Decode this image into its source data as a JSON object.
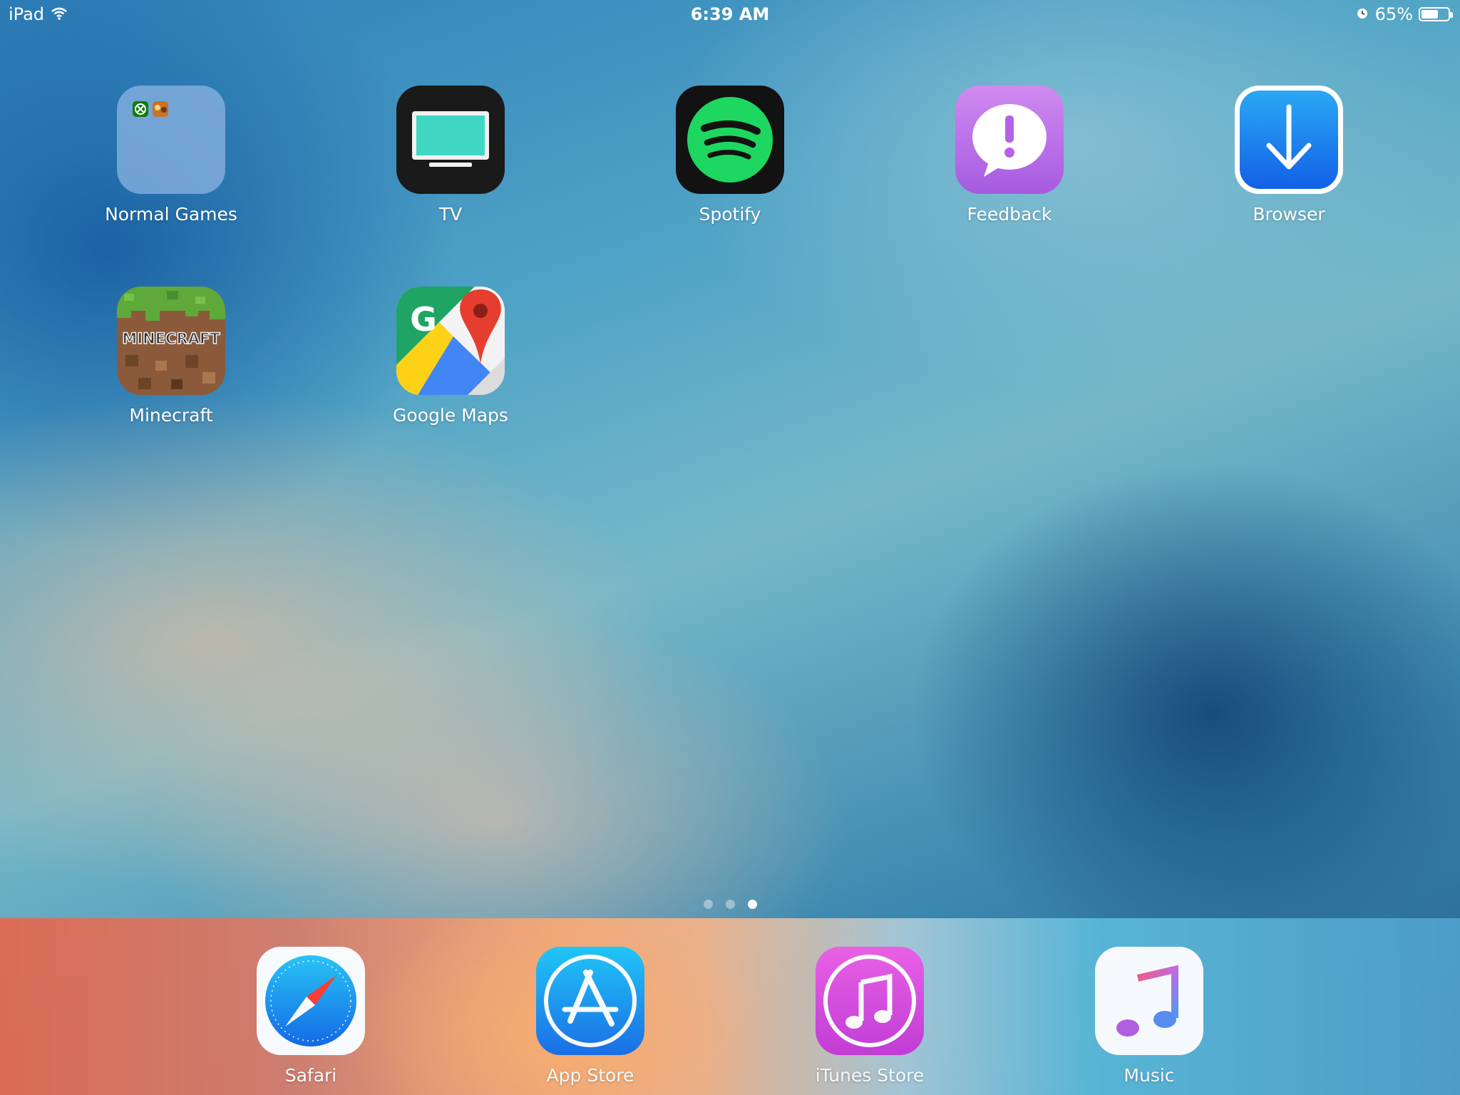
{
  "status_bar": {
    "device": "iPad",
    "time": "6:39 AM",
    "battery_percent": "65%",
    "battery_level": 0.65,
    "icons": [
      "wifi-icon",
      "alarm-icon",
      "battery-icon"
    ]
  },
  "home_apps": [
    {
      "name": "Normal Games",
      "icon": "folder-icon"
    },
    {
      "name": "TV",
      "icon": "tv-icon"
    },
    {
      "name": "Spotify",
      "icon": "spotify-icon"
    },
    {
      "name": "Feedback",
      "icon": "feedback-icon"
    },
    {
      "name": "Browser",
      "icon": "download-arrow-icon"
    },
    {
      "name": "Minecraft",
      "icon": "minecraft-icon"
    },
    {
      "name": "Google Maps",
      "icon": "google-maps-icon"
    }
  ],
  "minecraft_logo_text": "MINECRAFT",
  "google_maps_letter": "G",
  "page_indicator": {
    "pages": 3,
    "current": 3
  },
  "dock_apps": [
    {
      "name": "Safari",
      "icon": "safari-compass-icon"
    },
    {
      "name": "App Store",
      "icon": "app-store-icon"
    },
    {
      "name": "iTunes Store",
      "icon": "itunes-note-icon"
    },
    {
      "name": "Music",
      "icon": "music-note-icon"
    }
  ],
  "colors": {
    "spotify_green": "#1ed760",
    "feedback_purple": "#b56ae6",
    "browser_blue": "#1e7ff0",
    "appstore_blue": "#1a8cf0",
    "itunes_pink": "#e24ee0"
  }
}
